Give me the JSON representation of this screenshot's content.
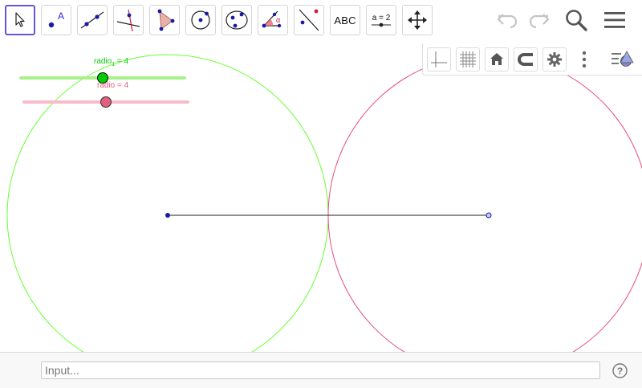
{
  "toolbar": {
    "tools": [
      {
        "name": "move-tool-icon"
      },
      {
        "name": "point-tool-icon"
      },
      {
        "name": "line-tool-icon"
      },
      {
        "name": "perpendicular-line-tool-icon"
      },
      {
        "name": "polygon-tool-icon"
      },
      {
        "name": "circle-center-point-tool-icon"
      },
      {
        "name": "conic-tool-icon"
      },
      {
        "name": "angle-tool-icon"
      },
      {
        "name": "reflect-tool-icon"
      },
      {
        "name": "text-tool-icon"
      },
      {
        "name": "slider-tool-icon"
      },
      {
        "name": "move-graphics-view-tool-icon"
      }
    ],
    "text_tool_label": "ABC",
    "slider_tool_label": "a = 2",
    "right": {
      "undo": "undo-icon",
      "redo": "redo-icon",
      "search": "search-icon",
      "menu": "hamburger-menu-icon"
    }
  },
  "stylebar": {
    "buttons": [
      "axes-icon",
      "grid-icon",
      "standard-view-home-icon",
      "point-capturing-magnet-icon",
      "settings-gear-icon",
      "more-options-icon",
      "toggle-style-bar-icon"
    ]
  },
  "graphics": {
    "slider1": {
      "label_main": "radio",
      "label_sub": "1",
      "label_rest": " = 4",
      "value": 4,
      "color": "#00cc00",
      "track_color": "#a8f08a"
    },
    "slider2": {
      "label": "radio = 4",
      "value": 4,
      "color": "#e0607e",
      "track_color": "#f7bccb"
    },
    "circle1_color": "#66ff33",
    "circle2_color": "#e64d7a",
    "segment_color": "#222222",
    "point_color": "#1a1aa6"
  },
  "input": {
    "placeholder": "Input..."
  },
  "help_label": "?"
}
